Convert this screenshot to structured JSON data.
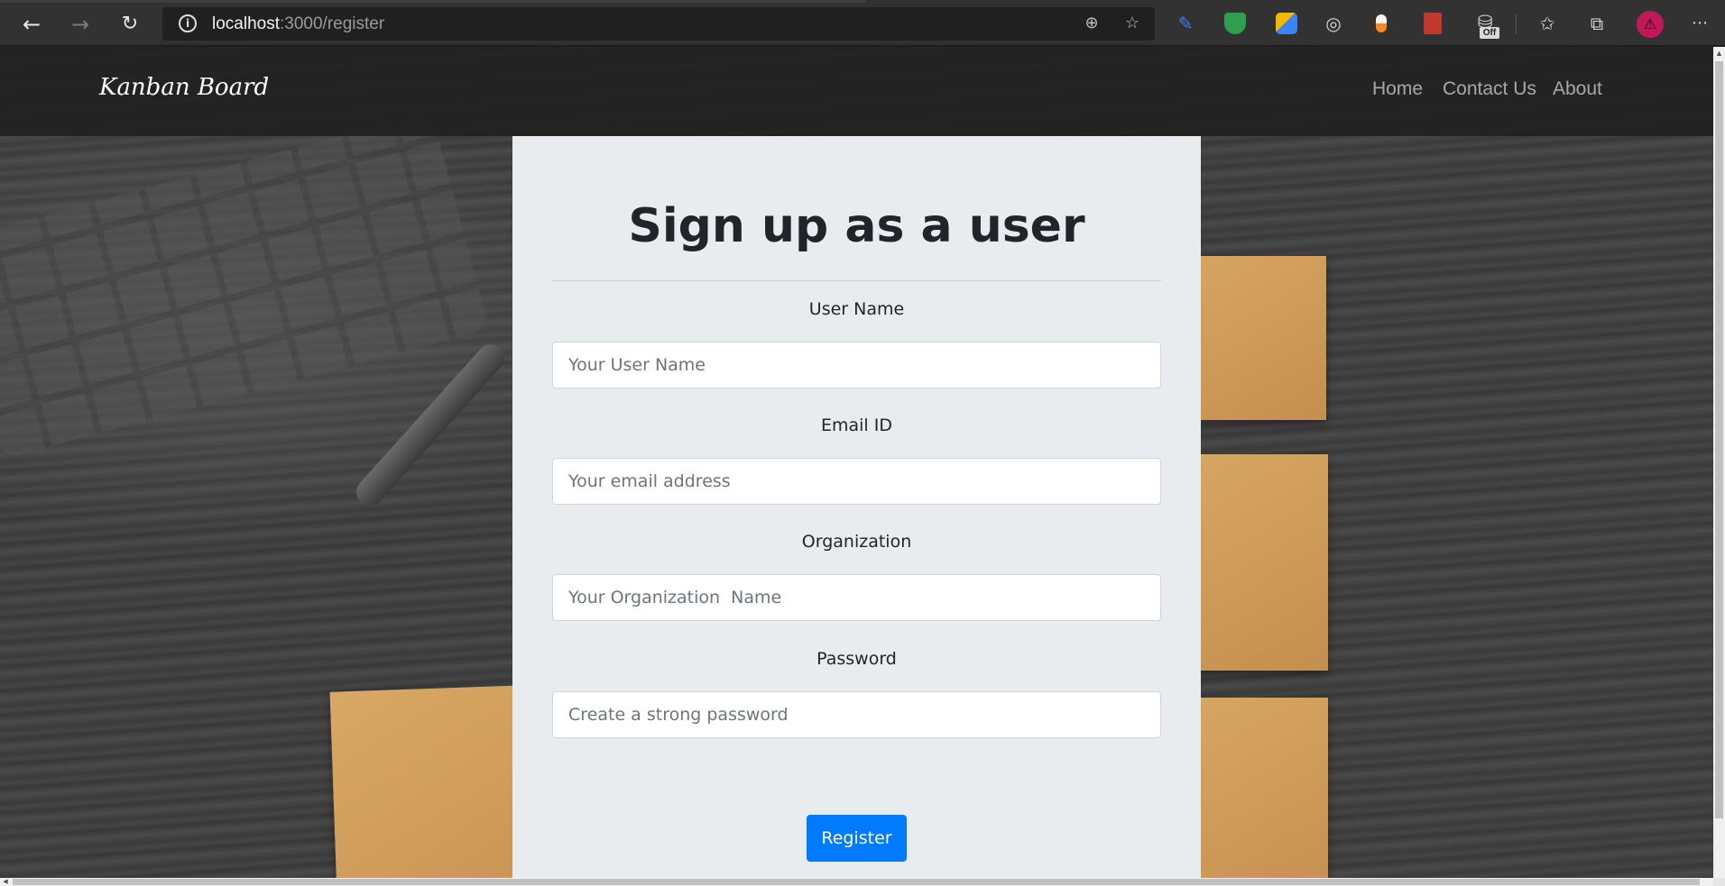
{
  "browser": {
    "back_icon": "back-arrow-icon",
    "forward_icon": "forward-arrow-icon",
    "reload_icon": "reload-icon",
    "url_host": "localhost",
    "url_path": ":3000/register",
    "extensions": [
      "pen-extension-icon",
      "shield-extension-icon",
      "color-picker-extension-icon",
      "target-extension-icon",
      "capsule-extension-icon",
      "book-extension-icon",
      "cookie-off-extension-icon"
    ],
    "off_badge": "Off"
  },
  "navbar": {
    "brand": "Kanban Board",
    "links": [
      "Home",
      "Contact Us",
      "About"
    ]
  },
  "form": {
    "title": "Sign up as a user",
    "fields": [
      {
        "label": "User Name",
        "placeholder": "Your User Name",
        "value": ""
      },
      {
        "label": "Email ID",
        "placeholder": "Your email address",
        "value": ""
      },
      {
        "label": "Organization",
        "placeholder": "Your Organization  Name",
        "value": ""
      },
      {
        "label": "Password",
        "placeholder": "Create a strong password",
        "value": ""
      }
    ],
    "submit_label": "Register",
    "submit_color": "#007bff"
  },
  "colors": {
    "navbar_bg": "#222222",
    "card_bg": "#e9ecef",
    "avatar": "#c2185b"
  }
}
